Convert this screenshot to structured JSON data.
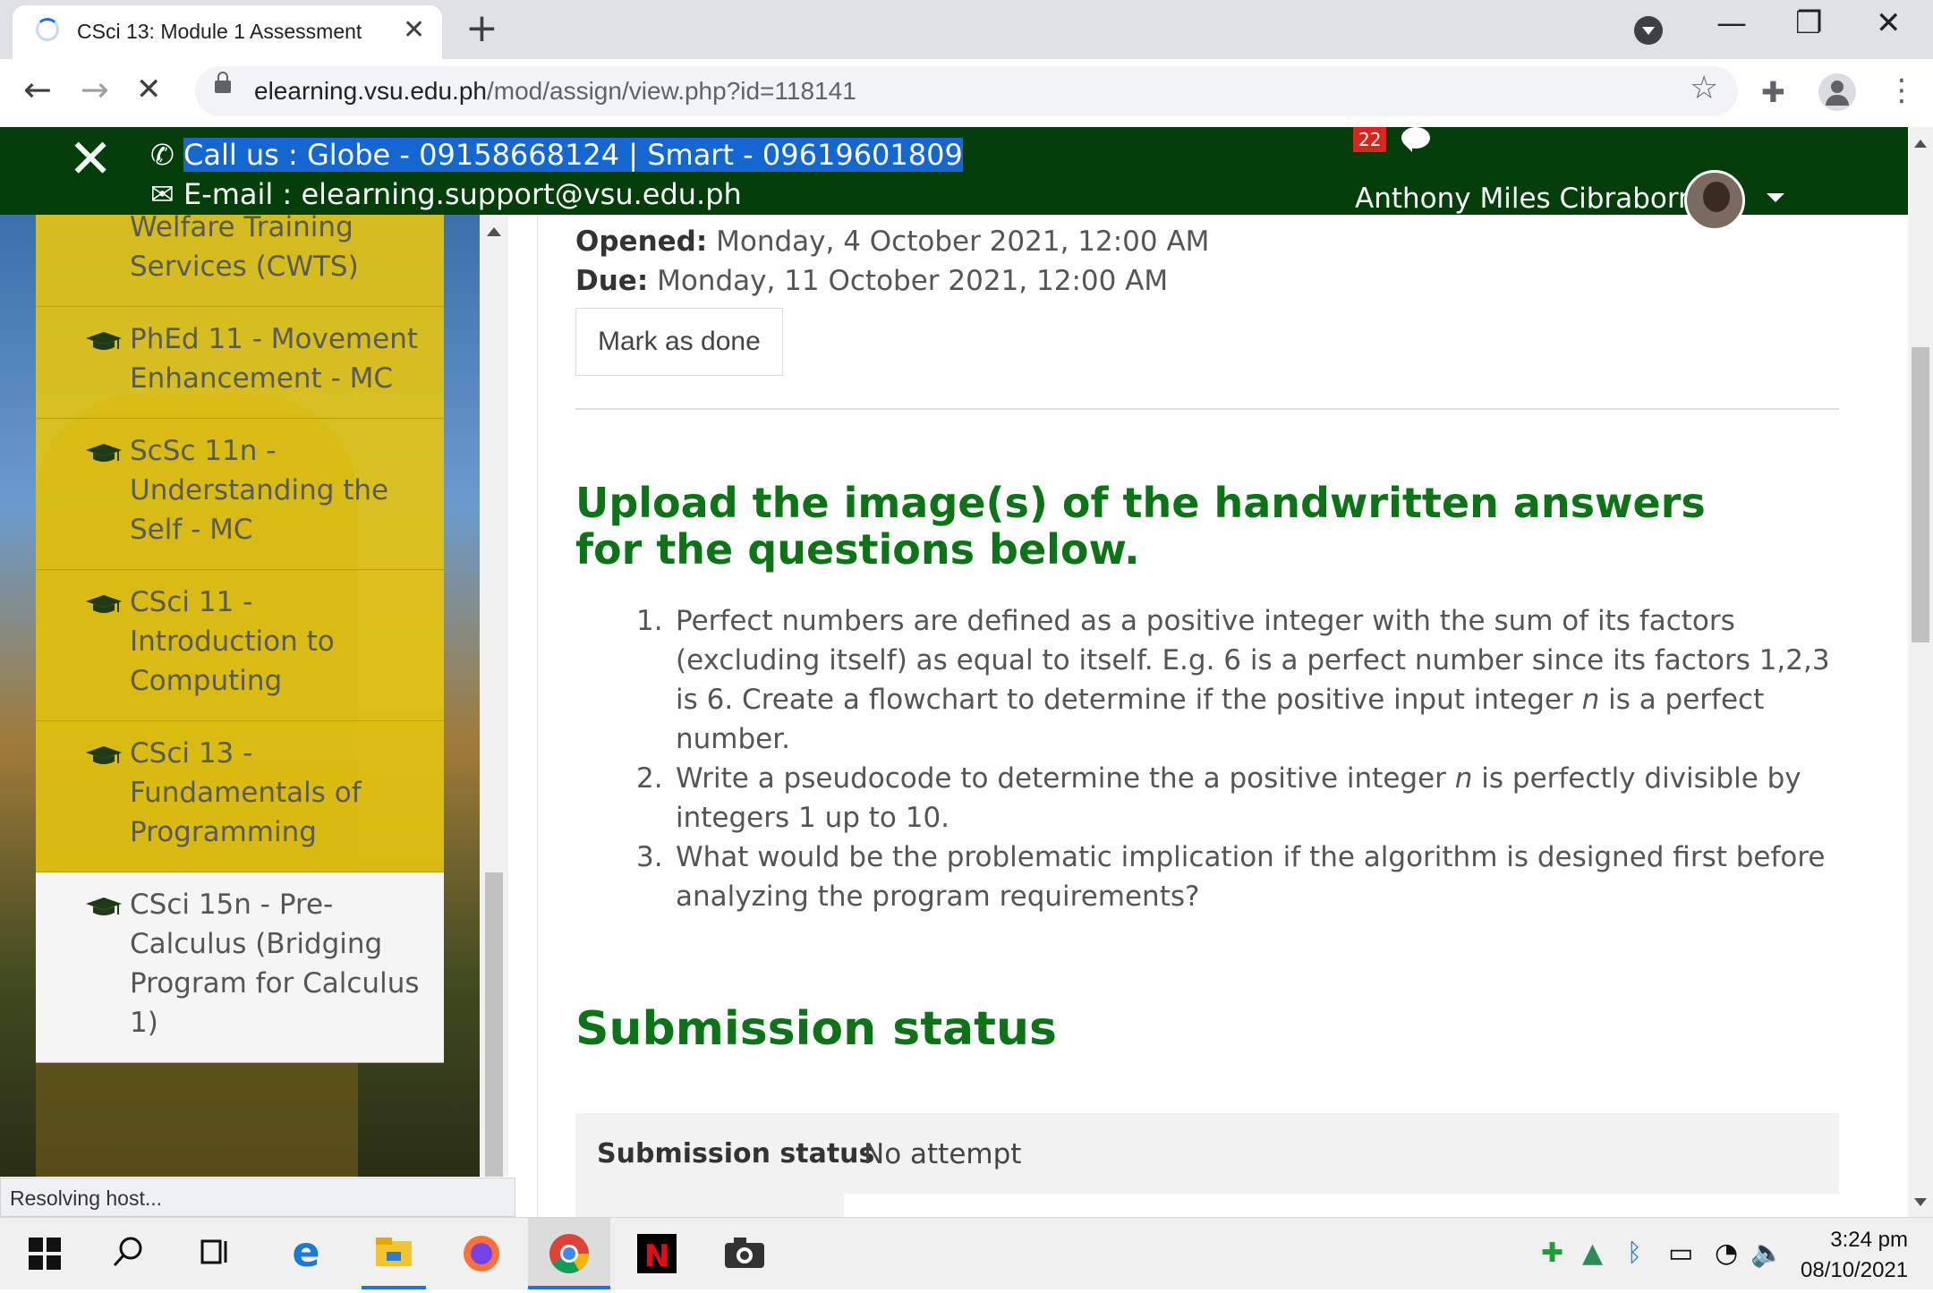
{
  "browser": {
    "tab_title": "CSci 13: Module 1 Assessment",
    "tab_close": "✕",
    "new_tab": "+",
    "url_domain": "elearning.vsu.edu.ph",
    "url_path": "/mod/assign/view.php?id=118141",
    "back": "←",
    "forward": "→",
    "stop": "✕",
    "window_minimize": "—",
    "window_restore": "❐",
    "window_close": "✕"
  },
  "header": {
    "close_menu": "✕",
    "call_prefix": "✆ ",
    "call_text": "Call us : Globe - 09158668124 | Smart - 09619601809",
    "email_text": "✉ E-mail : elearning.support@vsu.edu.ph",
    "notification_count": "22",
    "user_name": "Anthony Miles Cibraborn"
  },
  "sidebar": {
    "courses": [
      {
        "label": "Welfare Training Services (CWTS)",
        "show_cap": false,
        "current": false
      },
      {
        "label": "PhEd 11 - Movement Enhancement - MC",
        "show_cap": true,
        "current": false
      },
      {
        "label": "ScSc 11n - Understanding the Self - MC",
        "show_cap": true,
        "current": false
      },
      {
        "label": "CSci 11 - Introduction to Computing",
        "show_cap": true,
        "current": false
      },
      {
        "label": "CSci 13 - Fundamentals of Programming",
        "show_cap": true,
        "current": false
      },
      {
        "label": "CSci 15n - Pre-Calculus (Bridging Program for Calculus 1)",
        "show_cap": true,
        "current": true
      }
    ]
  },
  "status_bar": "Resolving host...",
  "assignment": {
    "opened_label": "Opened:",
    "opened_value": " Monday, 4 October 2021, 12:00 AM",
    "due_label": "Due:",
    "due_value": " Monday, 11 October 2021, 12:00 AM",
    "mark_done": "Mark as done",
    "instructions_title": "Upload the image(s) of the handwritten answers for the questions below.",
    "questions": [
      {
        "num": "1.",
        "text_before": "Perfect numbers are defined as a positive integer with the sum of its factors (excluding itself) as equal to itself. E.g. 6 is a perfect number since its factors 1,2,3 is 6. Create a flowchart to determine if the positive input integer ",
        "var": "n",
        "text_after": " is a perfect number."
      },
      {
        "num": "2.",
        "text_before": "Write a pseudocode to determine the a positive integer ",
        "var": "n",
        "text_after": " is perfectly divisible by integers 1 up to 10."
      },
      {
        "num": "3.",
        "text_before": "What would be the problematic implication if the algorithm is designed first before analyzing the program requirements?",
        "var": "",
        "text_after": ""
      }
    ],
    "submission_title": "Submission status",
    "submission_status_label": "Submission status",
    "submission_status_value": "No attempt"
  },
  "taskbar": {
    "time": "3:24 pm",
    "date": "08/10/2021"
  },
  "colors": {
    "header_bg": "#023d0a",
    "heading_green": "#0c7417",
    "sidebar_yellow": "#e4c410",
    "selection_blue": "#1467d0"
  }
}
